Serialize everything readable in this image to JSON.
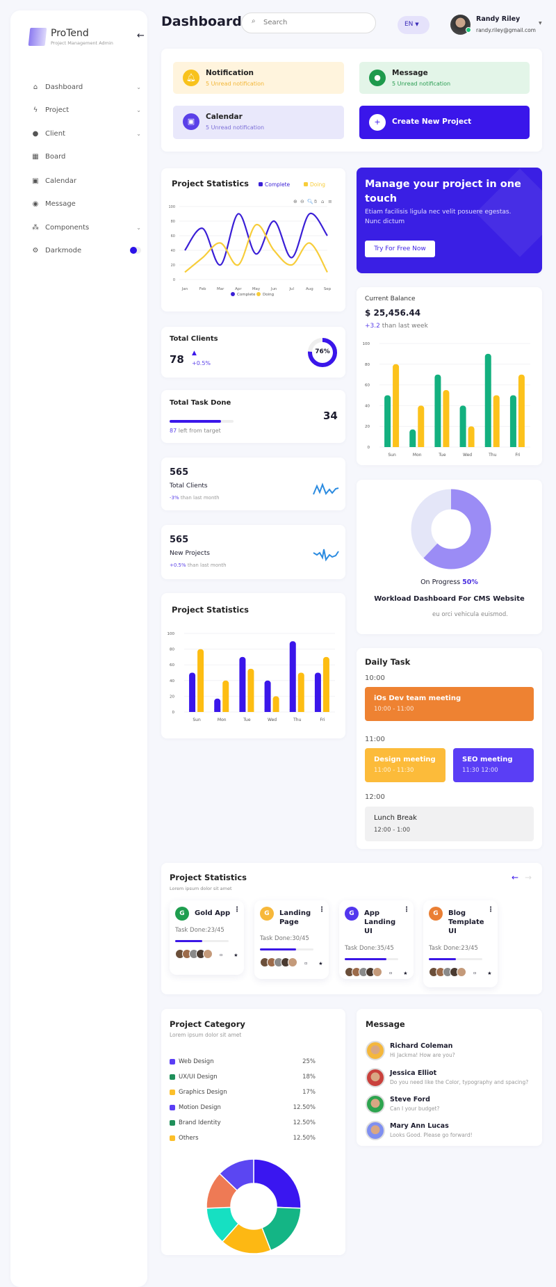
{
  "sidebar": {
    "brand": "ProTend",
    "brand_sub": "Project Management Admin",
    "items": [
      {
        "label": "Dashboard",
        "icon": "home-icon",
        "chev": true
      },
      {
        "label": "Project",
        "icon": "bolt-icon",
        "chev": true
      },
      {
        "label": "Client",
        "icon": "user-icon",
        "chev": true
      },
      {
        "label": "Board",
        "icon": "grid-icon",
        "chev": false
      },
      {
        "label": "Calendar",
        "icon": "calendar-icon",
        "chev": false
      },
      {
        "label": "Message",
        "icon": "chat-icon",
        "chev": false
      },
      {
        "label": "Components",
        "icon": "components-icon",
        "chev": true
      },
      {
        "label": "Darkmode",
        "icon": "gear-icon",
        "chev": false
      }
    ],
    "darkmode_on": false
  },
  "header": {
    "title": "Dashboard",
    "search_placeholder": "Search",
    "lang": "EN",
    "user_name": "Randy Riley",
    "user_email": "randy.riley@gmail.com"
  },
  "quick": {
    "notification": {
      "title": "Notification",
      "sub": "5 Unread notification"
    },
    "message": {
      "title": "Message",
      "sub": "5 Unread notification"
    },
    "calendar": {
      "title": "Calendar",
      "sub": "5 Unread notification"
    },
    "create": "Create New Project"
  },
  "promo": {
    "title": "Manage your project in one touch",
    "text": "Etiam facilisis ligula nec velit posuere egestas. Nunc dictum",
    "button": "Try For Free Now"
  },
  "total_clients": {
    "title": "Total Clients",
    "value": "78",
    "delta": "+0.5%",
    "ring": "76%",
    "ring_fraction": 0.76
  },
  "total_task": {
    "title": "Total Task Done",
    "value": "34",
    "left_num": "87",
    "left_text": "left from target",
    "progress": 0.8
  },
  "stat1": {
    "value": "565",
    "label": "Total Clients",
    "delta": "-3%",
    "delta_text": "than last month"
  },
  "stat2": {
    "value": "565",
    "label": "New Projects",
    "delta": "+0.5%",
    "delta_text": "than last month"
  },
  "workload": {
    "progress_label": "On Progress",
    "progress_value": "50%",
    "donut_fraction": 0.62,
    "title": "Workload Dashboard For CMS Website",
    "desc": "eu orci vehicula euismod."
  },
  "daily": {
    "title": "Daily Task",
    "slots": [
      "10:00",
      "11:00",
      "12:00"
    ],
    "tasks": [
      {
        "title": "iOs Dev team meeting",
        "time": "10:00 - 11:00",
        "color": "#ee8232"
      },
      {
        "title": "Design meeting",
        "time": "11:00 - 11:30",
        "color": "#fcbb3a"
      },
      {
        "title": "SEO meeting",
        "time": "11:30 12:00",
        "color": "#5a3ef5"
      },
      {
        "title": "Lunch Break",
        "time": "12:00 - 1:00",
        "color": "#f1f1f2"
      }
    ]
  },
  "projects": {
    "title": "Project Statistics",
    "subtitle": "Lorem ipsum dolor sit amet",
    "cards": [
      {
        "name": "Gold App",
        "done": "Task Done:23/45",
        "progress": 0.51,
        "color": "#1f9e4f"
      },
      {
        "name": "Landing Page",
        "done": "Task Done:30/45",
        "progress": 0.67,
        "color": "#f7b83a"
      },
      {
        "name": "App Landing UI",
        "done": "Task Done:35/45",
        "progress": 0.78,
        "color": "#5236ee"
      },
      {
        "name": "Blog Template UI",
        "done": "Task Done:23/45",
        "progress": 0.51,
        "color": "#ea7f34"
      }
    ],
    "initial": "G"
  },
  "category": {
    "title": "Project Category",
    "subtitle": "Lorem ipsum dolor sit amet",
    "items": [
      {
        "label": "Web Design",
        "pct": "25%",
        "color": "#5a3ef5"
      },
      {
        "label": "UX/UI Design",
        "pct": "18%",
        "color": "#1f8f5a"
      },
      {
        "label": "Graphics Design",
        "pct": "17%",
        "color": "#fcbf2a"
      },
      {
        "label": "Motion Design",
        "pct": "12.50%",
        "color": "#5a3ef5"
      },
      {
        "label": "Brand Identity",
        "pct": "12.50%",
        "color": "#1f8f5a"
      },
      {
        "label": "Others",
        "pct": "12.50%",
        "color": "#fcbf2a"
      }
    ]
  },
  "messages": {
    "title": "Message",
    "items": [
      {
        "name": "Richard Coleman",
        "text": "Hi Jackma! How are you?",
        "color": "#f4b73c"
      },
      {
        "name": "Jessica Elliot",
        "text": "Do you need like the Color, typography and spacing?",
        "color": "#c9413c"
      },
      {
        "name": "Steve Ford",
        "text": "Can I your budget?",
        "color": "#2ea44f"
      },
      {
        "name": "Mary Ann Lucas",
        "text": "Looks Good. Please go forward!",
        "color": "#7f8ff0"
      }
    ]
  },
  "chart_data": [
    {
      "type": "line",
      "title": "Project Statistics",
      "categories": [
        "Jan",
        "Feb",
        "Mar",
        "Apr",
        "May",
        "Jun",
        "Jul",
        "Aug",
        "Sep"
      ],
      "series": [
        {
          "name": "Complete",
          "values": [
            40,
            70,
            20,
            90,
            35,
            80,
            30,
            90,
            60
          ],
          "color": "#3a1fd6"
        },
        {
          "name": "Doing",
          "values": [
            10,
            30,
            50,
            20,
            75,
            40,
            20,
            50,
            10
          ],
          "color": "#f7cd3a"
        }
      ],
      "ylim": [
        0,
        100
      ],
      "yticks": [
        0,
        20,
        40,
        60,
        80,
        100
      ],
      "grid": true,
      "legend": "top-right"
    },
    {
      "type": "bar",
      "title": "Current Balance",
      "amount": "$ 25,456.44",
      "delta": "+3.2",
      "delta_text": "than last week",
      "categories": [
        "Sun",
        "Mon",
        "Tue",
        "Wed",
        "Thu",
        "Fri"
      ],
      "series": [
        {
          "values": [
            50,
            17,
            70,
            40,
            90,
            50
          ],
          "color": "#13b07f"
        },
        {
          "values": [
            80,
            40,
            55,
            20,
            50,
            70
          ],
          "color": "#fcc21c"
        }
      ],
      "ylim": [
        0,
        100
      ],
      "yticks": [
        0,
        20,
        40,
        60,
        80,
        100
      ]
    },
    {
      "type": "bar",
      "title": "Project Statistics",
      "categories": [
        "Sun",
        "Mon",
        "Tue",
        "Wed",
        "Thu",
        "Fri"
      ],
      "series": [
        {
          "values": [
            50,
            17,
            70,
            40,
            90,
            50
          ],
          "color": "#3a16ea"
        },
        {
          "values": [
            80,
            40,
            55,
            20,
            50,
            70
          ],
          "color": "#fdbd12"
        }
      ],
      "ylim": [
        0,
        100
      ],
      "yticks": [
        0,
        20,
        40,
        60,
        80,
        100
      ]
    },
    {
      "type": "pie",
      "title": "Project Category",
      "values": [
        25,
        18,
        17,
        12.5,
        12.5,
        12.5
      ],
      "colors": [
        "#3a16f0",
        "#14b585",
        "#fdb813",
        "#16e0c2",
        "#ee7a55",
        "#5b46f2"
      ]
    }
  ]
}
